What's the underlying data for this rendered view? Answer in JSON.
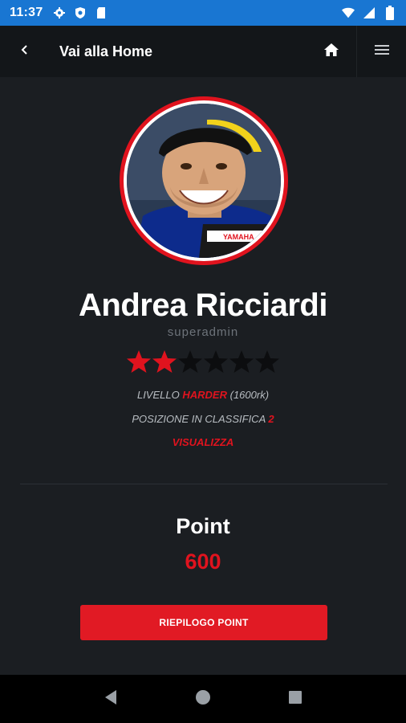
{
  "status_bar": {
    "time": "11:37",
    "left_icons": [
      "gear-icon",
      "shield-icon",
      "sd-card-icon"
    ],
    "right_icons": [
      "wifi-icon",
      "signal-icon",
      "battery-icon"
    ],
    "bg_color": "#1976d2"
  },
  "header": {
    "back_icon": "chevron-left-icon",
    "title": "Vai alla Home",
    "home_icon": "home-icon",
    "menu_icon": "hamburger-menu-icon"
  },
  "profile": {
    "name": "Andrea Ricciardi",
    "role": "superadmin",
    "rating": {
      "filled": 2,
      "total": 6
    },
    "level_prefix": "LIVELLO",
    "level_value": "HARDER",
    "level_suffix": "(1600rk)",
    "rank_prefix": "POSIZIONE IN CLASSIFICA",
    "rank_value": "2",
    "view_link": "VISUALIZZA"
  },
  "points": {
    "label": "Point",
    "value": "600",
    "summary_button": "RIEPILOGO POINT"
  },
  "colors": {
    "accent": "#e0131e",
    "background": "#1b1e22",
    "header_bg": "#131619"
  },
  "nav_bar": {
    "icons": [
      "back-triangle-icon",
      "home-circle-icon",
      "recents-square-icon"
    ]
  }
}
